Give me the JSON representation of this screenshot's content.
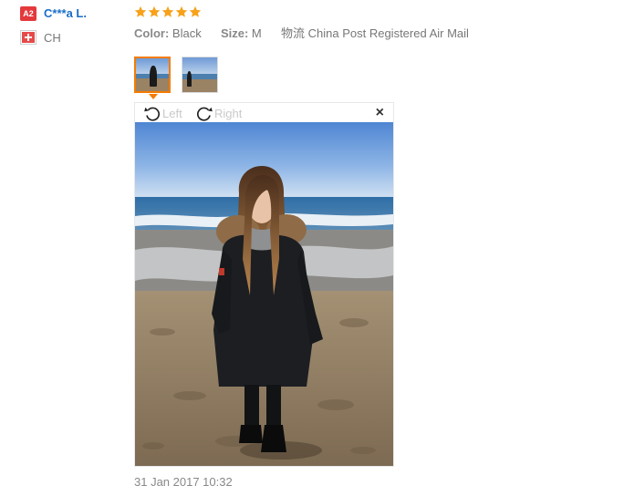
{
  "review": {
    "badge": "A2",
    "username": "C***a L.",
    "country": "CH",
    "flag_icon": "swiss-flag-icon",
    "rating": 5,
    "color_label": "Color:",
    "color_value": "Black",
    "size_label": "Size:",
    "size_value": "M",
    "shipping": "物流 China Post Registered Air Mail",
    "timestamp": "31 Jan 2017 10:32"
  },
  "viewer": {
    "rotate_left_label": "Left",
    "rotate_right_label": "Right",
    "close_symbol": "×"
  },
  "colors": {
    "accent_orange": "#f57c00",
    "star": "#f7a21b",
    "badge_red": "#e4393c",
    "link_blue": "#1a6ec8"
  }
}
